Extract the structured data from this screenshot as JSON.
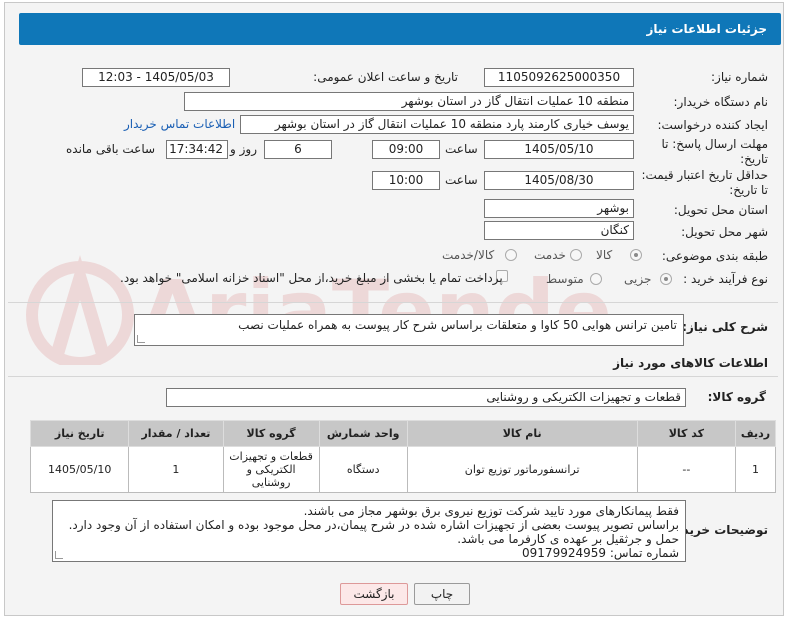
{
  "header": {
    "title": "جزئیات اطلاعات نیاز"
  },
  "fields": {
    "need_number_label": "شماره نیاز:",
    "need_number": "1105092625000350",
    "announce_label": "تاریخ و ساعت اعلان عمومی:",
    "announce_value": "1405/05/03 - 12:03",
    "buyer_org_label": "نام دستگاه خریدار:",
    "buyer_org": "منطقه 10 عملیات انتقال گاز در استان بوشهر",
    "creator_label": "ایجاد کننده درخواست:",
    "creator": "یوسف خیاری کارمند پارد منطقه 10 عملیات انتقال گاز در استان بوشهر",
    "contact_link": "اطلاعات تماس خریدار",
    "deadline_label_1": "مهلت ارسال پاسخ: تا",
    "deadline_label_2": "تاریخ:",
    "deadline_date": "1405/05/10",
    "time_word": "ساعت",
    "deadline_time": "09:00",
    "days_value": "6",
    "days_word": "روز و",
    "remaining_time": "17:34:42",
    "remaining_word": "ساعت باقی مانده",
    "validity_label_1": "حداقل تاریخ اعتبار قیمت:",
    "validity_label_2": "تا تاریخ:",
    "validity_date": "1405/08/30",
    "validity_time": "10:00",
    "province_label": "استان محل تحویل:",
    "province": "بوشهر",
    "city_label": "شهر محل تحویل:",
    "city": "کنگان",
    "category_label": "طبقه بندی موضوعی:",
    "category_options": [
      "کالا",
      "خدمت",
      "کالا/خدمت"
    ],
    "process_label": "نوع فرآیند خرید :",
    "process_options": [
      "جزیی",
      "متوسط"
    ],
    "payment_note": "پرداخت تمام یا بخشی از مبلغ خرید،از محل \"اسناد خزانه اسلامی\" خواهد بود."
  },
  "description": {
    "label": "شرح کلی نیاز:",
    "text": "تامین ترانس هوایی 50 کاوا و متعلقات براساس شرح کار پیوست به همراه عملیات نصب"
  },
  "goods_info": {
    "section_title": "اطلاعات کالاهای مورد نیاز",
    "group_label": "گروه کالا:",
    "group_value": "قطعات و تجهیزات الکتریکی و روشنایی"
  },
  "table": {
    "headers": [
      "ردیف",
      "کد کالا",
      "نام کالا",
      "واحد شمارش",
      "گروه کالا",
      "تعداد / مقدار",
      "تاریخ نیاز"
    ],
    "rows": [
      [
        "1",
        "--",
        "ترانسفورماتور توزیع توان",
        "دستگاه",
        "قطعات و تجهیزات الکتریکی و روشنایی",
        "1",
        "1405/05/10"
      ]
    ]
  },
  "buyer_notes": {
    "label": "توضیحات خریدار:",
    "lines": [
      "فقط پیمانکارهای مورد تایید شرکت توزیع نیروی برق بوشهر مجاز می باشند.",
      "براساس تصویر پیوست بعضی از تجهیزات اشاره شده در شرح پیمان،در محل موجود بوده و امکان استفاده از آن وجود دارد.",
      "حمل و جرثقیل بر عهده ی کارفرما می باشد.",
      "شماره تماس: 09179924959"
    ]
  },
  "buttons": {
    "print": "چاپ",
    "back": "بازگشت"
  },
  "watermark_text": "AriaTender.net",
  "colors": {
    "header": "#0f77b8",
    "link": "#1a5fb4",
    "back_button": "#fce8e8"
  }
}
